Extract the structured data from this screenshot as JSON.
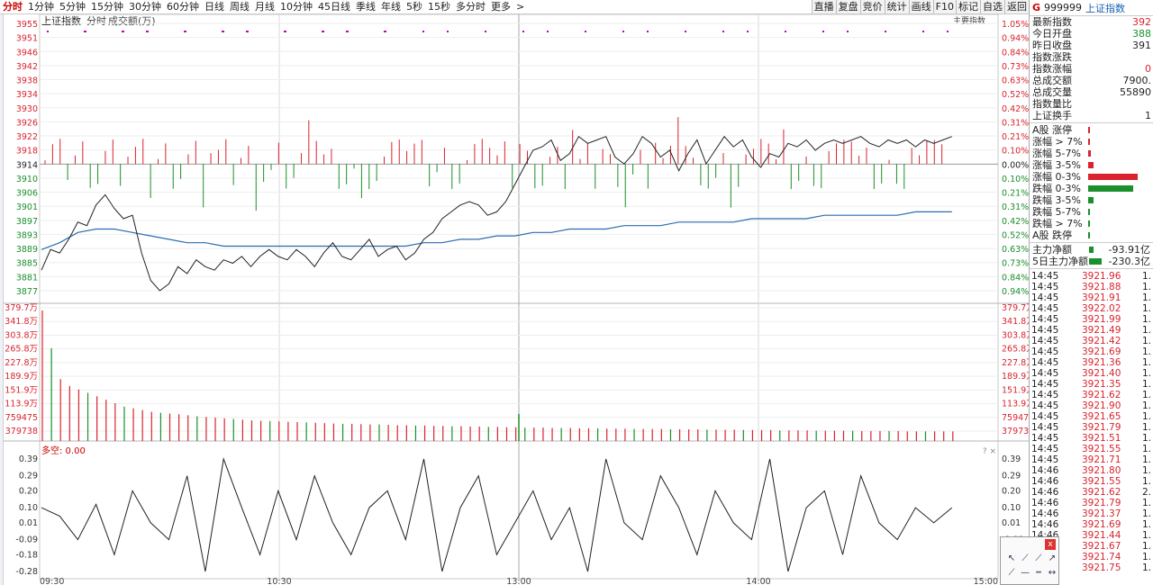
{
  "toolbar": {
    "timeframes": [
      "分时",
      "1分钟",
      "5分钟",
      "15分钟",
      "30分钟",
      "60分钟",
      "日线",
      "周线",
      "月线",
      "10分钟",
      "45日线",
      "季线",
      "年线",
      "5秒",
      "15秒",
      "多分时",
      "更多"
    ],
    "active_timeframe": "分时",
    "more_chevron": ">",
    "right_buttons": [
      "直播",
      "复盘",
      "竞价",
      "统计",
      "画线",
      "F10",
      "标记",
      "自选",
      "返回"
    ]
  },
  "chart": {
    "title": "上证指数",
    "subtitle": "分时",
    "subtitle2": "成交额(万)",
    "main_indicator_label": "主要指数",
    "price_ticks": [
      "3955",
      "3951",
      "3946",
      "3942",
      "3938",
      "3934",
      "3930",
      "3926",
      "3922",
      "3918",
      "3914",
      "3910",
      "3906",
      "3901",
      "3897",
      "3893",
      "3889",
      "3885",
      "3881",
      "3877"
    ],
    "pct_ticks": [
      "1.05%",
      "0.94%",
      "0.84%",
      "0.73%",
      "0.63%",
      "0.52%",
      "0.42%",
      "0.31%",
      "0.21%",
      "0.10%",
      "0.00%",
      "0.10%",
      "0.21%",
      "0.31%",
      "0.42%",
      "0.52%",
      "0.63%",
      "0.73%",
      "0.84%",
      "0.94%"
    ],
    "volume_ticks": [
      "379.7万",
      "341.8万",
      "303.8万",
      "265.8万",
      "227.8万",
      "189.9万",
      "151.9万",
      "113.9万",
      "759475",
      "379738"
    ],
    "bullbear_label": "多空: 0.00",
    "bullbear_ticks": [
      "0.39",
      "0.29",
      "0.20",
      "0.10",
      "0.01",
      "-0.09",
      "-0.18",
      "-0.28"
    ],
    "time_labels": [
      "09:30",
      "10:30",
      "13:00",
      "14:00",
      "15:00"
    ],
    "colors": {
      "up": "#d9232d",
      "down": "#1a8f2b",
      "price_line": "#222222",
      "avg_line": "#2b6cb0",
      "grid": "#d8d8d8",
      "marker": "#c000c0"
    }
  },
  "panel": {
    "header": {
      "mark": "G",
      "code": "999999",
      "name": "上证指数"
    },
    "stats": [
      {
        "label": "最新指数",
        "value": "392",
        "color": "red"
      },
      {
        "label": "今日开盘",
        "value": "388",
        "color": "green"
      },
      {
        "label": "昨日收盘",
        "value": "391",
        "color": "dark"
      },
      {
        "label": "指数涨跌",
        "value": "",
        "color": "red"
      },
      {
        "label": "指数涨幅",
        "value": "0",
        "color": "red"
      },
      {
        "label": "总成交额",
        "value": "7900.",
        "color": "dark"
      },
      {
        "label": "总成交量",
        "value": "55890",
        "color": "dark"
      },
      {
        "label": "指数量比",
        "value": "",
        "color": "dark"
      },
      {
        "label": "上证换手",
        "value": "1",
        "color": "dark"
      }
    ],
    "distribution": [
      {
        "label": "A股 涨停",
        "level": 0.03,
        "color": "red"
      },
      {
        "label": "涨幅 > 7%",
        "level": 0.04,
        "color": "red"
      },
      {
        "label": "涨幅 5-7%",
        "level": 0.05,
        "color": "red"
      },
      {
        "label": "涨幅 3-5%",
        "level": 0.1,
        "color": "red"
      },
      {
        "label": "涨幅 0-3%",
        "level": 0.98,
        "color": "red"
      },
      {
        "label": "跌幅 0-3%",
        "level": 0.9,
        "color": "green"
      },
      {
        "label": "跌幅 3-5%",
        "level": 0.1,
        "color": "green"
      },
      {
        "label": "跌幅 5-7%",
        "level": 0.03,
        "color": "green"
      },
      {
        "label": "跌幅 > 7%",
        "level": 0.02,
        "color": "green"
      },
      {
        "label": "A股 跌停",
        "level": 0.01,
        "color": "green"
      }
    ],
    "flows": [
      {
        "label": "主力净额",
        "value": "-93.91亿",
        "level": 0.15
      },
      {
        "label": "5日主力净额",
        "value": "-230.3亿",
        "level": 0.45
      }
    ],
    "ticks": [
      {
        "time": "14:45",
        "price": "3921.96",
        "vol": "1."
      },
      {
        "time": "14:45",
        "price": "3921.88",
        "vol": "1."
      },
      {
        "time": "14:45",
        "price": "3921.91",
        "vol": "1."
      },
      {
        "time": "14:45",
        "price": "3922.02",
        "vol": "1."
      },
      {
        "time": "14:45",
        "price": "3921.99",
        "vol": "1."
      },
      {
        "time": "14:45",
        "price": "3921.49",
        "vol": "1."
      },
      {
        "time": "14:45",
        "price": "3921.42",
        "vol": "1."
      },
      {
        "time": "14:45",
        "price": "3921.69",
        "vol": "1."
      },
      {
        "time": "14:45",
        "price": "3921.36",
        "vol": "1."
      },
      {
        "time": "14:45",
        "price": "3921.40",
        "vol": "1."
      },
      {
        "time": "14:45",
        "price": "3921.35",
        "vol": "1."
      },
      {
        "time": "14:45",
        "price": "3921.62",
        "vol": "1."
      },
      {
        "time": "14:45",
        "price": "3921.90",
        "vol": "1."
      },
      {
        "time": "14:45",
        "price": "3921.65",
        "vol": "1."
      },
      {
        "time": "14:45",
        "price": "3921.79",
        "vol": "1."
      },
      {
        "time": "14:45",
        "price": "3921.51",
        "vol": "1."
      },
      {
        "time": "14:45",
        "price": "3921.55",
        "vol": "1."
      },
      {
        "time": "14:45",
        "price": "3921.71",
        "vol": "1."
      },
      {
        "time": "14:46",
        "price": "3921.80",
        "vol": "1."
      },
      {
        "time": "14:46",
        "price": "3921.55",
        "vol": "1."
      },
      {
        "time": "14:46",
        "price": "3921.62",
        "vol": "2."
      },
      {
        "time": "14:46",
        "price": "3921.79",
        "vol": "1."
      },
      {
        "time": "14:46",
        "price": "3921.37",
        "vol": "1."
      },
      {
        "time": "14:46",
        "price": "3921.69",
        "vol": "1."
      },
      {
        "time": "14:46",
        "price": "3921.44",
        "vol": "1."
      },
      {
        "time": "14:46",
        "price": "3921.67",
        "vol": "1."
      },
      {
        "time": "14:46",
        "price": "3921.74",
        "vol": "1."
      },
      {
        "time": "14:46",
        "price": "3921.75",
        "vol": "1."
      }
    ]
  },
  "draw_tools": {
    "close_label": "x",
    "icons": [
      "cursor-icon",
      "line-icon",
      "ray-icon",
      "arrow-icon",
      "segment-icon",
      "hline-icon",
      "dash-icon",
      "double-arrow-icon"
    ]
  },
  "chart_data": {
    "type": "line",
    "title": "上证指数",
    "x_labels": [
      "09:30",
      "10:30",
      "13:00",
      "14:00",
      "15:00"
    ],
    "ylim": [
      3877,
      3955
    ],
    "prev_close": 3914,
    "series": [
      {
        "name": "",
        "values": [
          3883,
          3889,
          3888,
          3892,
          3897,
          3896,
          3902,
          3905,
          3901,
          3898,
          3899,
          3888,
          3880,
          3877,
          3879,
          3884,
          3882,
          3886,
          3884,
          3883,
          3886,
          3885,
          3887,
          3884,
          3887,
          3889,
          3887,
          3886,
          3889,
          3887,
          3884,
          3888,
          3891,
          3887,
          3886,
          3889,
          3892,
          3887,
          3889,
          3890,
          3886,
          3888,
          3892,
          3894,
          3898,
          3900,
          3902,
          3903,
          3902,
          3899,
          3900,
          3903,
          3908,
          3913,
          3918,
          3919,
          3921,
          3915,
          3917,
          3922,
          3920,
          3921,
          3922,
          3916,
          3914,
          3917,
          3922,
          3920,
          3916,
          3918,
          3912,
          3917,
          3921,
          3914,
          3918,
          3922,
          3919,
          3921,
          3916,
          3913,
          3917,
          3916,
          3920,
          3919,
          3921,
          3918,
          3920,
          3921,
          3920,
          3921,
          3922,
          3920,
          3919,
          3921,
          3920,
          3921,
          3919,
          3921,
          3920,
          3921,
          3922
        ]
      },
      {
        "name": "",
        "values": [
          3889,
          3891,
          3894,
          3895,
          3895,
          3894,
          3893,
          3892,
          3891,
          3891,
          3890,
          3890,
          3890,
          3890,
          3890,
          3890,
          3890,
          3890,
          3890,
          3890,
          3890,
          3891,
          3891,
          3892,
          3892,
          3893,
          3893,
          3894,
          3894,
          3895,
          3895,
          3895,
          3896,
          3896,
          3896,
          3897,
          3897,
          3897,
          3897,
          3898,
          3898,
          3898,
          3898,
          3899,
          3899,
          3899,
          3899,
          3899,
          3900,
          3900,
          3900
        ]
      }
    ],
    "volume": [
      379.7,
      270,
      180,
      160,
      150,
      140,
      130,
      120,
      110,
      100,
      95,
      90,
      85,
      82,
      80,
      78,
      75,
      72,
      70,
      68,
      66,
      64,
      62,
      60,
      59,
      58,
      57,
      56,
      55,
      54,
      53,
      52,
      51,
      50,
      50,
      49,
      48,
      48,
      47,
      46,
      46,
      45,
      45,
      44,
      44,
      43,
      43,
      42,
      42,
      41,
      41,
      40,
      40,
      39,
      39,
      39,
      38,
      38,
      38,
      37,
      37,
      37,
      36,
      36,
      36,
      35,
      35,
      35,
      35,
      34,
      34,
      34,
      34,
      33,
      33,
      33,
      33,
      32,
      32,
      32,
      32,
      31,
      31,
      31,
      31,
      30,
      30,
      30,
      30,
      30,
      29,
      29,
      29,
      29,
      29,
      28,
      28,
      28,
      28,
      28,
      28
    ],
    "bullbear": [
      0.1,
      0.05,
      -0.09,
      0.12,
      -0.18,
      0.2,
      0.01,
      -0.09,
      0.29,
      -0.28,
      0.39,
      0.1,
      -0.18,
      0.2,
      -0.09,
      0.29,
      0.01,
      -0.18,
      0.1,
      0.2,
      -0.09,
      0.39,
      -0.28,
      0.1,
      0.29,
      -0.18,
      0.01,
      0.2,
      -0.09,
      0.1,
      -0.28,
      0.39,
      0.01,
      -0.09,
      0.29,
      0.1,
      -0.18,
      0.2,
      0.01,
      -0.09,
      0.39,
      -0.28,
      0.1,
      0.2,
      -0.18,
      0.29,
      0.01,
      -0.09,
      0.1,
      0.01,
      0.1
    ]
  }
}
